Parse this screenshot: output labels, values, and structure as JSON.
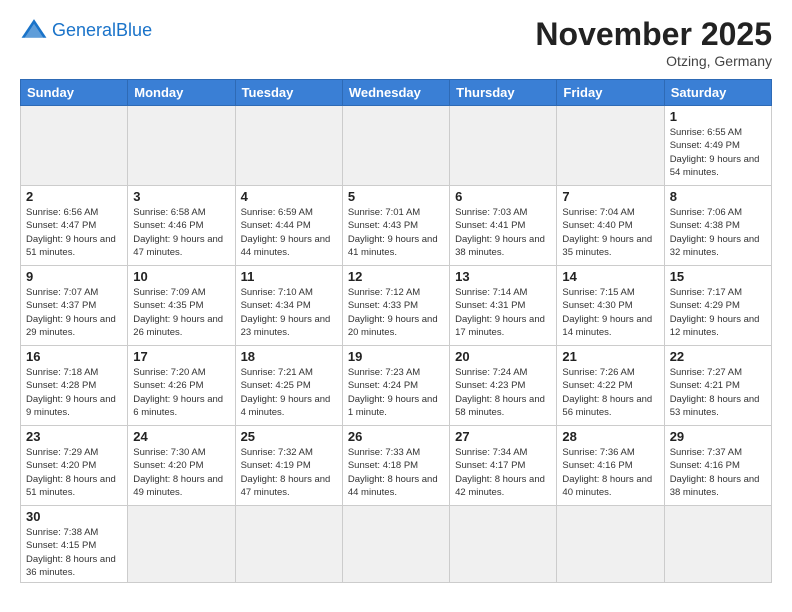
{
  "logo": {
    "text_general": "General",
    "text_blue": "Blue"
  },
  "header": {
    "month": "November 2025",
    "location": "Otzing, Germany"
  },
  "weekdays": [
    "Sunday",
    "Monday",
    "Tuesday",
    "Wednesday",
    "Thursday",
    "Friday",
    "Saturday"
  ],
  "weeks": [
    [
      {
        "day": "",
        "info": "",
        "empty": true
      },
      {
        "day": "",
        "info": "",
        "empty": true
      },
      {
        "day": "",
        "info": "",
        "empty": true
      },
      {
        "day": "",
        "info": "",
        "empty": true
      },
      {
        "day": "",
        "info": "",
        "empty": true
      },
      {
        "day": "",
        "info": "",
        "empty": true
      },
      {
        "day": "1",
        "info": "Sunrise: 6:55 AM\nSunset: 4:49 PM\nDaylight: 9 hours\nand 54 minutes."
      }
    ],
    [
      {
        "day": "2",
        "info": "Sunrise: 6:56 AM\nSunset: 4:47 PM\nDaylight: 9 hours\nand 51 minutes."
      },
      {
        "day": "3",
        "info": "Sunrise: 6:58 AM\nSunset: 4:46 PM\nDaylight: 9 hours\nand 47 minutes."
      },
      {
        "day": "4",
        "info": "Sunrise: 6:59 AM\nSunset: 4:44 PM\nDaylight: 9 hours\nand 44 minutes."
      },
      {
        "day": "5",
        "info": "Sunrise: 7:01 AM\nSunset: 4:43 PM\nDaylight: 9 hours\nand 41 minutes."
      },
      {
        "day": "6",
        "info": "Sunrise: 7:03 AM\nSunset: 4:41 PM\nDaylight: 9 hours\nand 38 minutes."
      },
      {
        "day": "7",
        "info": "Sunrise: 7:04 AM\nSunset: 4:40 PM\nDaylight: 9 hours\nand 35 minutes."
      },
      {
        "day": "8",
        "info": "Sunrise: 7:06 AM\nSunset: 4:38 PM\nDaylight: 9 hours\nand 32 minutes."
      }
    ],
    [
      {
        "day": "9",
        "info": "Sunrise: 7:07 AM\nSunset: 4:37 PM\nDaylight: 9 hours\nand 29 minutes."
      },
      {
        "day": "10",
        "info": "Sunrise: 7:09 AM\nSunset: 4:35 PM\nDaylight: 9 hours\nand 26 minutes."
      },
      {
        "day": "11",
        "info": "Sunrise: 7:10 AM\nSunset: 4:34 PM\nDaylight: 9 hours\nand 23 minutes."
      },
      {
        "day": "12",
        "info": "Sunrise: 7:12 AM\nSunset: 4:33 PM\nDaylight: 9 hours\nand 20 minutes."
      },
      {
        "day": "13",
        "info": "Sunrise: 7:14 AM\nSunset: 4:31 PM\nDaylight: 9 hours\nand 17 minutes."
      },
      {
        "day": "14",
        "info": "Sunrise: 7:15 AM\nSunset: 4:30 PM\nDaylight: 9 hours\nand 14 minutes."
      },
      {
        "day": "15",
        "info": "Sunrise: 7:17 AM\nSunset: 4:29 PM\nDaylight: 9 hours\nand 12 minutes."
      }
    ],
    [
      {
        "day": "16",
        "info": "Sunrise: 7:18 AM\nSunset: 4:28 PM\nDaylight: 9 hours\nand 9 minutes."
      },
      {
        "day": "17",
        "info": "Sunrise: 7:20 AM\nSunset: 4:26 PM\nDaylight: 9 hours\nand 6 minutes."
      },
      {
        "day": "18",
        "info": "Sunrise: 7:21 AM\nSunset: 4:25 PM\nDaylight: 9 hours\nand 4 minutes."
      },
      {
        "day": "19",
        "info": "Sunrise: 7:23 AM\nSunset: 4:24 PM\nDaylight: 9 hours\nand 1 minute."
      },
      {
        "day": "20",
        "info": "Sunrise: 7:24 AM\nSunset: 4:23 PM\nDaylight: 8 hours\nand 58 minutes."
      },
      {
        "day": "21",
        "info": "Sunrise: 7:26 AM\nSunset: 4:22 PM\nDaylight: 8 hours\nand 56 minutes."
      },
      {
        "day": "22",
        "info": "Sunrise: 7:27 AM\nSunset: 4:21 PM\nDaylight: 8 hours\nand 53 minutes."
      }
    ],
    [
      {
        "day": "23",
        "info": "Sunrise: 7:29 AM\nSunset: 4:20 PM\nDaylight: 8 hours\nand 51 minutes."
      },
      {
        "day": "24",
        "info": "Sunrise: 7:30 AM\nSunset: 4:20 PM\nDaylight: 8 hours\nand 49 minutes."
      },
      {
        "day": "25",
        "info": "Sunrise: 7:32 AM\nSunset: 4:19 PM\nDaylight: 8 hours\nand 47 minutes."
      },
      {
        "day": "26",
        "info": "Sunrise: 7:33 AM\nSunset: 4:18 PM\nDaylight: 8 hours\nand 44 minutes."
      },
      {
        "day": "27",
        "info": "Sunrise: 7:34 AM\nSunset: 4:17 PM\nDaylight: 8 hours\nand 42 minutes."
      },
      {
        "day": "28",
        "info": "Sunrise: 7:36 AM\nSunset: 4:16 PM\nDaylight: 8 hours\nand 40 minutes."
      },
      {
        "day": "29",
        "info": "Sunrise: 7:37 AM\nSunset: 4:16 PM\nDaylight: 8 hours\nand 38 minutes."
      }
    ],
    [
      {
        "day": "30",
        "info": "Sunrise: 7:38 AM\nSunset: 4:15 PM\nDaylight: 8 hours\nand 36 minutes."
      },
      {
        "day": "",
        "info": "",
        "empty": true
      },
      {
        "day": "",
        "info": "",
        "empty": true
      },
      {
        "day": "",
        "info": "",
        "empty": true
      },
      {
        "day": "",
        "info": "",
        "empty": true
      },
      {
        "day": "",
        "info": "",
        "empty": true
      },
      {
        "day": "",
        "info": "",
        "empty": true
      }
    ]
  ]
}
